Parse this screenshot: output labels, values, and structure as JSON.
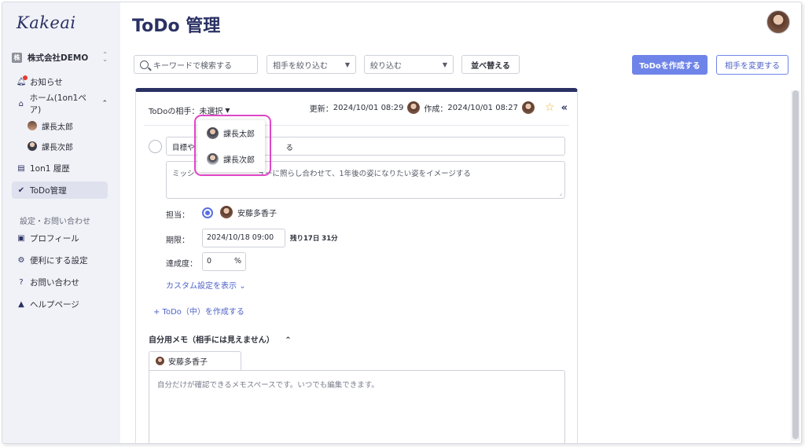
{
  "app": {
    "logo": "Kakeai",
    "title": "ToDo 管理"
  },
  "sidebar": {
    "company": {
      "badge": "株",
      "name": "株式会社DEMO"
    },
    "items": [
      {
        "label": "お知らせ",
        "icon": "bell-icon"
      },
      {
        "label": "ホーム(1on1ペア)",
        "icon": "home-icon"
      },
      {
        "label": "課長太郎",
        "icon": "avatar"
      },
      {
        "label": "課長次郎",
        "icon": "avatar"
      },
      {
        "label": "1on1 履歴",
        "icon": "history-icon"
      },
      {
        "label": "ToDo管理",
        "icon": "check-circle-icon",
        "active": true
      }
    ],
    "settings_section": "設定・お問い合わせ",
    "settings_items": [
      {
        "label": "プロフィール",
        "icon": "id-card-icon"
      },
      {
        "label": "便利にする設定",
        "icon": "gear-icon"
      },
      {
        "label": "お問い合わせ",
        "icon": "question-icon"
      },
      {
        "label": "ヘルプページ",
        "icon": "graduation-cap-icon"
      }
    ]
  },
  "toolbar": {
    "search_placeholder": "キーワードで検索する",
    "filter_partner": "相手を絞り込む",
    "filter_narrow": "絞り込む",
    "sort_label": "並べ替える",
    "create_label": "ToDoを作成する",
    "change_partner_label": "相手を変更する"
  },
  "card": {
    "partner_label": "ToDoの相手：",
    "partner_value": "未選択",
    "updated_label": "更新：",
    "updated_value": "2024/10/01 08:29",
    "created_label": "作成：",
    "created_value": "2024/10/01 08:27",
    "goal_visible_start": "目標や",
    "goal_visible_end": "る",
    "desc_visible_start": "ミッシ",
    "desc_visible_end": "ューに照らし合わせて、1年後の姿になりたい姿をイメージする",
    "assignee_label": "担当：",
    "assignee_name": "安藤多香子",
    "deadline_label": "期限：",
    "deadline_value": "2024/10/18 09:00",
    "remaining": "残り17日 31分",
    "progress_label": "達成度：",
    "progress_value": "0",
    "progress_unit": "%",
    "custom_settings": "カスタム設定を表示",
    "add_todo": "+  ToDo（中）を作成する",
    "memo_title": "自分用メモ（相手には見えません）",
    "memo_tab": "安藤多香子",
    "memo_placeholder": "自分だけが確認できるメモスペースです。いつでも編集できます。"
  },
  "dropdown": {
    "options": [
      "課長太郎",
      "課長次郎"
    ]
  },
  "colors": {
    "brand": "#2a3163",
    "primary": "#6f84e8",
    "highlight": "#e046c8",
    "star": "#f0b429"
  }
}
